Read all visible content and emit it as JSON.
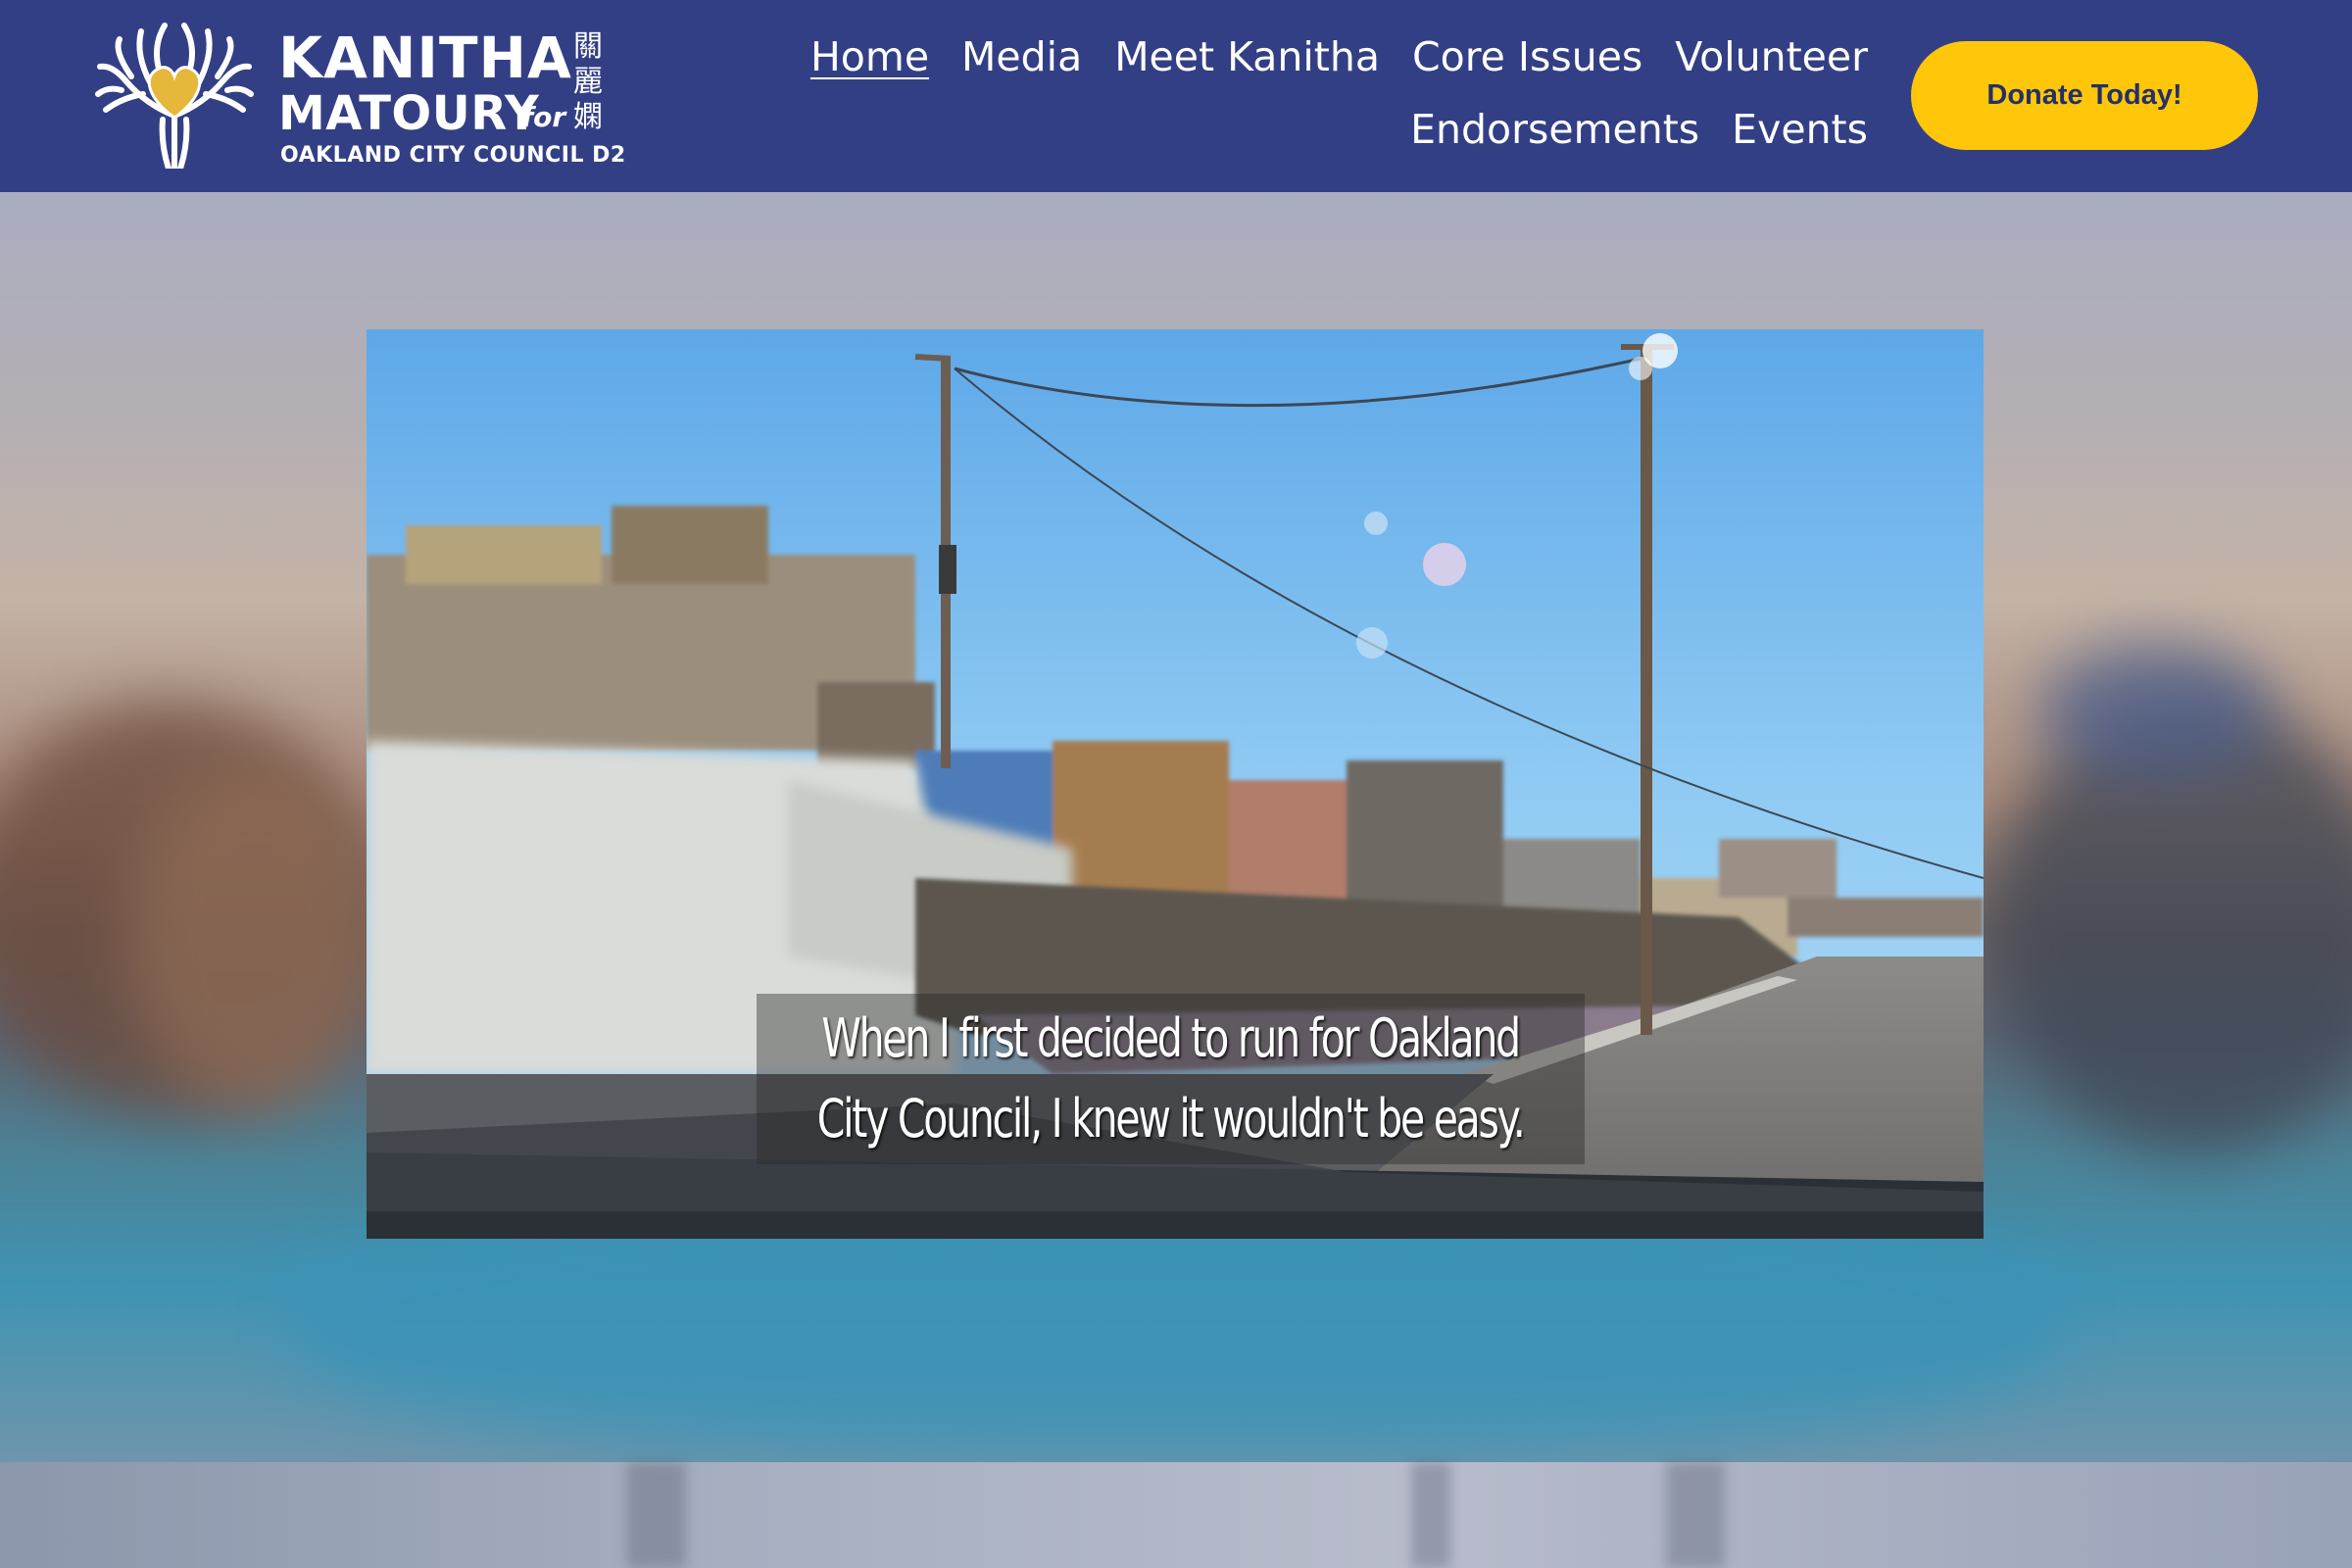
{
  "header": {
    "logo": {
      "name_line_1": "KANITHA",
      "name_line_2": "MATOURY",
      "for_word": "for",
      "subtitle": "OAKLAND CITY COUNCIL D2",
      "chinese_name": [
        "關",
        "麗",
        "嫻"
      ],
      "icon": "heart-tree-icon"
    },
    "nav": {
      "home": "Home",
      "media": "Media",
      "meet": "Meet Kanitha",
      "issues": "Core Issues",
      "volunteer": "Volunteer",
      "endorsements": "Endorsements",
      "events": "Events"
    },
    "donate_label": "Donate Today!"
  },
  "hero": {
    "video": {
      "caption_line_1": "When I first decided to run for Oakland",
      "caption_line_2": "City Council, I knew it wouldn't be easy."
    }
  },
  "colors": {
    "header_bg": "#333f85",
    "donate_bg": "#ffc60a",
    "donate_text": "#243066",
    "logo_heart": "#e5b73a"
  }
}
